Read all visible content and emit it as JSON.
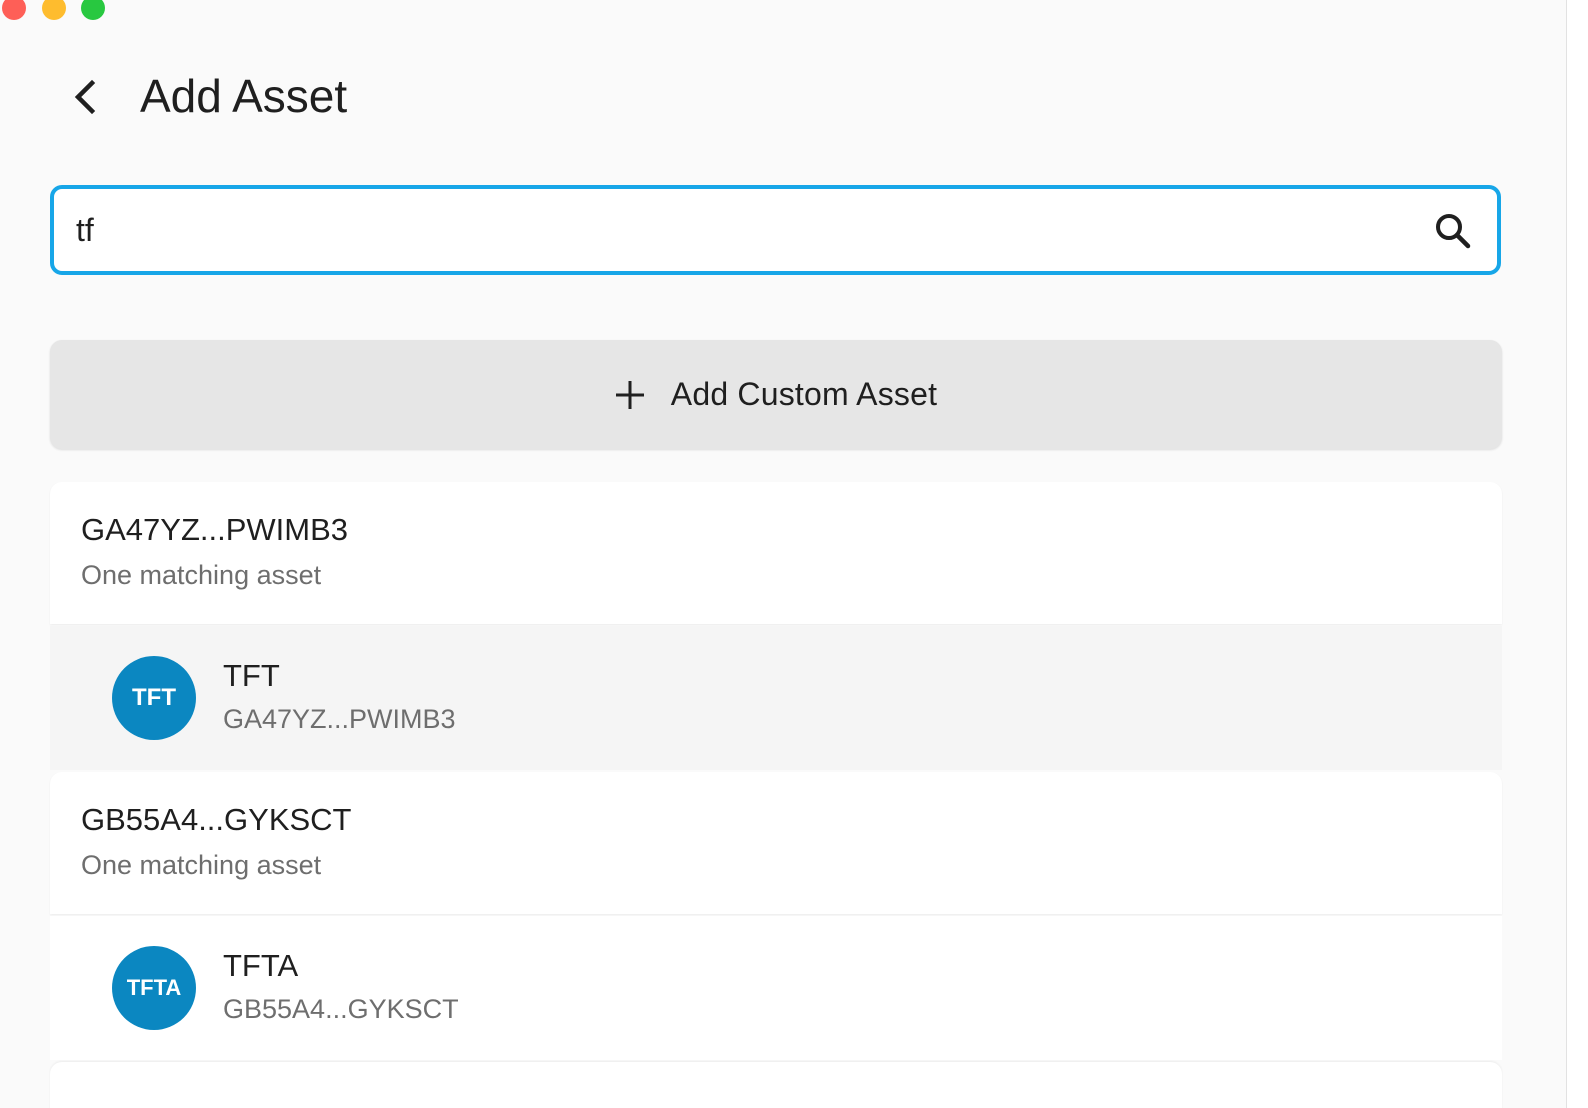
{
  "window": {
    "controls": [
      "close",
      "minimize",
      "maximize"
    ]
  },
  "header": {
    "title": "Add Asset",
    "back_icon": "chevron-left-icon"
  },
  "search": {
    "value": "tf",
    "placeholder": "",
    "icon": "search-icon"
  },
  "add_custom": {
    "label": "Add Custom Asset",
    "icon": "plus-icon"
  },
  "groups": [
    {
      "issuer": "GA47YZ...PWIMB3",
      "subtitle": "One matching asset",
      "assets": [
        {
          "avatar": "TFT",
          "code": "TFT",
          "issuer": "GA47YZ...PWIMB3"
        }
      ]
    },
    {
      "issuer": "GB55A4...GYKSCT",
      "subtitle": "One matching asset",
      "assets": [
        {
          "avatar": "TFTA",
          "code": "TFTA",
          "issuer": "GB55A4...GYKSCT"
        }
      ]
    }
  ],
  "colors": {
    "accent": "#17a6e8",
    "avatar": "#0b87c1",
    "background": "#fafafa",
    "button": "#e6e6e6"
  }
}
